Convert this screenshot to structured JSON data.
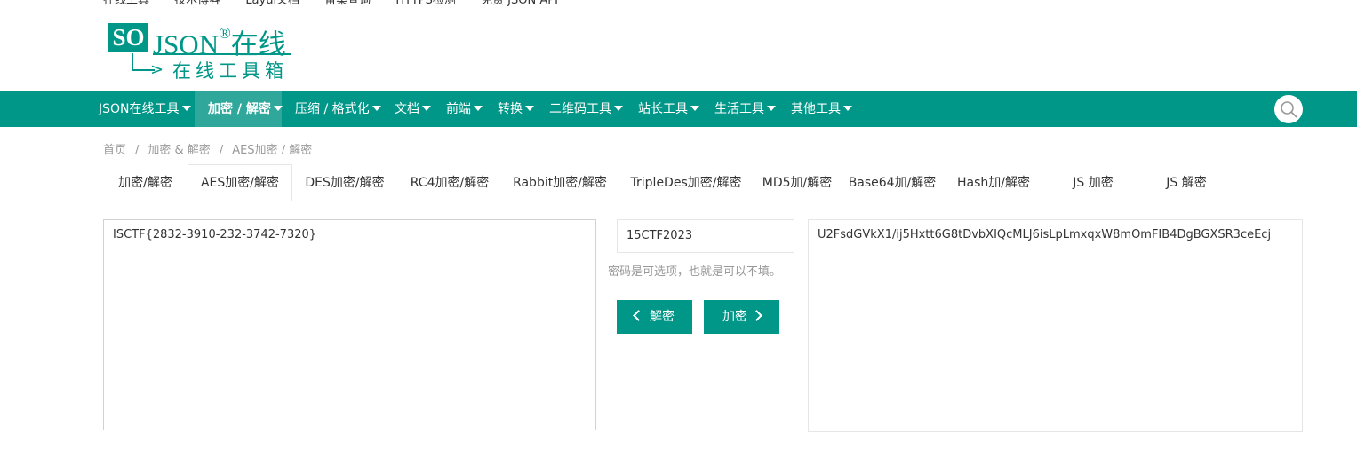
{
  "top_links": [
    "在线工具",
    "技术博客",
    "Layui文档",
    "备案查询",
    "HTTPS检测",
    "免费 JSON API"
  ],
  "logo": {
    "brand_box": "SO",
    "brand_text": "JSON",
    "registered": "®",
    "brand_suffix": "在线",
    "tagline": "在线工具箱"
  },
  "nav": [
    {
      "label": "JSON在线工具"
    },
    {
      "label": "加密 / 解密"
    },
    {
      "label": "压缩 / 格式化"
    },
    {
      "label": "文档"
    },
    {
      "label": "前端"
    },
    {
      "label": "转换"
    },
    {
      "label": "二维码工具"
    },
    {
      "label": "站长工具"
    },
    {
      "label": "生活工具"
    },
    {
      "label": "其他工具"
    }
  ],
  "breadcrumb": [
    "首页",
    "加密 & 解密",
    "AES加密 / 解密"
  ],
  "tabs": [
    {
      "label": "加密/解密"
    },
    {
      "label": "AES加密/解密"
    },
    {
      "label": "DES加密/解密"
    },
    {
      "label": "RC4加密/解密"
    },
    {
      "label": "Rabbit加密/解密"
    },
    {
      "label": "TripleDes加密/解密"
    },
    {
      "label": "MD5加/解密"
    },
    {
      "label": "Base64加/解密"
    },
    {
      "label": "Hash加/解密"
    },
    {
      "label": "JS 加密"
    },
    {
      "label": "JS 解密"
    }
  ],
  "active_tab": "AES加密/解密",
  "active_nav": "加密 / 解密",
  "input_text": "ISCTF{2832-3910-232-3742-7320}",
  "password_value": "15CTF2023",
  "password_hint": "密码是可选项，也就是可以不填。",
  "buttons": {
    "decrypt": "解密",
    "encrypt": "加密"
  },
  "output_text": "U2FsdGVkX1/ij5Hxtt6G8tDvbXIQcMLJ6isLpLmxqxW8mOmFIB4DgBGXSR3ceEcj",
  "colors": {
    "accent": "#009688",
    "active_nav_bg": "#2fa79b"
  }
}
